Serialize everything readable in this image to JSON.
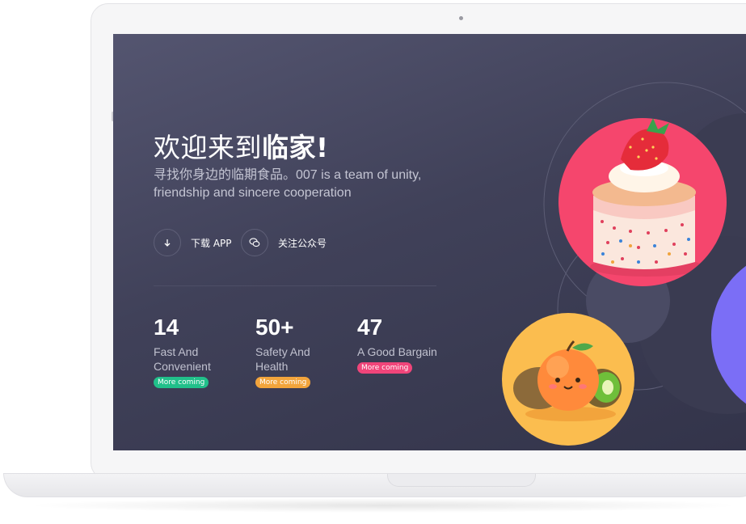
{
  "hero": {
    "title_light": "欢迎来到",
    "title_bold": "临家!",
    "subtitle": "寻找你身边的临期食品。007 is a team of unity, friendship and sincere cooperation"
  },
  "actions": [
    {
      "label": "下载 APP",
      "icon": "download-arrow-icon"
    },
    {
      "label": "关注公众号",
      "icon": "wechat-icon"
    }
  ],
  "stats": [
    {
      "number": "14",
      "description": "Fast And Convenient",
      "badge": "More coming",
      "badge_color": "#21c08a"
    },
    {
      "number": "50+",
      "description": "Safety And Health",
      "badge": "More coming",
      "badge_color": "#f2a43c"
    },
    {
      "number": "47",
      "description": "A Good Bargain",
      "badge": "More coming",
      "badge_color": "#f0457a"
    }
  ],
  "colors": {
    "screen_background": "#41425a",
    "cake_circle": "#f5466d",
    "fruit_circle": "#fbbd4f",
    "accent_purple": "#7b6ef6"
  },
  "illustrations": [
    "strawberry-cake-illustration",
    "orange-kiwi-illustration"
  ]
}
